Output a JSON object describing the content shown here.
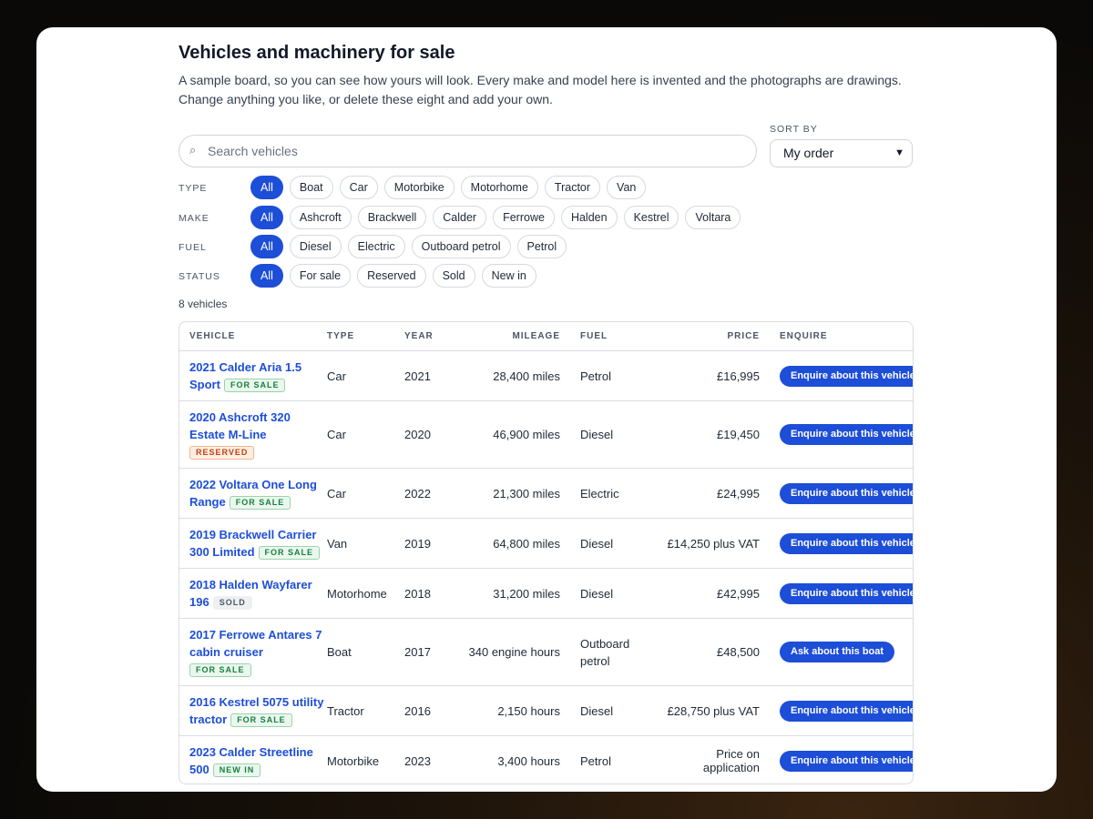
{
  "page": {
    "title": "Vehicles and machinery for sale",
    "intro": "A sample board, so you can see how yours will look. Every make and model here is invented and the photographs are drawings. Change anything you like, or delete these eight and add your own."
  },
  "search": {
    "placeholder": "Search vehicles",
    "icon": "search-icon"
  },
  "sort": {
    "label": "SORT BY",
    "selected": "My order"
  },
  "filters": {
    "type": {
      "label": "TYPE",
      "options": [
        "All",
        "Boat",
        "Car",
        "Motorbike",
        "Motorhome",
        "Tractor",
        "Van"
      ]
    },
    "make": {
      "label": "MAKE",
      "options": [
        "All",
        "Ashcroft",
        "Brackwell",
        "Calder",
        "Ferrowe",
        "Halden",
        "Kestrel",
        "Voltara"
      ]
    },
    "fuel": {
      "label": "FUEL",
      "options": [
        "All",
        "Diesel",
        "Electric",
        "Outboard petrol",
        "Petrol"
      ]
    },
    "status": {
      "label": "STATUS",
      "options": [
        "All",
        "For sale",
        "Reserved",
        "Sold",
        "New in"
      ]
    }
  },
  "results_count": "8 vehicles",
  "table": {
    "columns": {
      "vehicle": "VEHICLE",
      "type": "TYPE",
      "year": "YEAR",
      "mileage": "MILEAGE",
      "fuel": "FUEL",
      "price": "PRICE",
      "enquire": "ENQUIRE"
    },
    "rows": [
      {
        "line1": "2021 Calder Aria 1.5",
        "line2": "Sport",
        "badge": "FOR SALE",
        "badge_own_line": false,
        "type": "Car",
        "year": "2021",
        "mileage": "28,400 miles",
        "fuel": "Petrol",
        "price": "£16,995",
        "button": "Enquire about this vehicle"
      },
      {
        "line1": "2020 Ashcroft 320",
        "line2": "Estate M-Line",
        "badge": "RESERVED",
        "badge_own_line": true,
        "type": "Car",
        "year": "2020",
        "mileage": "46,900 miles",
        "fuel": "Diesel",
        "price": "£19,450",
        "button": "Enquire about this vehicle"
      },
      {
        "line1": "2022 Voltara One Long",
        "line2": "Range",
        "badge": "FOR SALE",
        "badge_own_line": false,
        "type": "Car",
        "year": "2022",
        "mileage": "21,300 miles",
        "fuel": "Electric",
        "price": "£24,995",
        "button": "Enquire about this vehicle"
      },
      {
        "line1": "2019 Brackwell Carrier",
        "line2": "300 Limited",
        "badge": "FOR SALE",
        "badge_own_line": false,
        "type": "Van",
        "year": "2019",
        "mileage": "64,800 miles",
        "fuel": "Diesel",
        "price": "£14,250 plus VAT",
        "button": "Enquire about this vehicle"
      },
      {
        "line1": "2018 Halden Wayfarer",
        "line2": "196",
        "badge": "SOLD",
        "badge_own_line": false,
        "type": "Motorhome",
        "year": "2018",
        "mileage": "31,200 miles",
        "fuel": "Diesel",
        "price": "£42,995",
        "button": "Enquire about this vehicle"
      },
      {
        "line1": "2017 Ferrowe Antares 7",
        "line2": "cabin cruiser",
        "badge": "FOR SALE",
        "badge_own_line": true,
        "type": "Boat",
        "year": "2017",
        "mileage": "340 engine hours",
        "fuel": "Outboard petrol",
        "price": "£48,500",
        "button": "Ask about this boat"
      },
      {
        "line1": "2016 Kestrel 5075 utility",
        "line2": "tractor",
        "badge": "FOR SALE",
        "badge_own_line": false,
        "type": "Tractor",
        "year": "2016",
        "mileage": "2,150 hours",
        "fuel": "Diesel",
        "price": "£28,750 plus VAT",
        "button": "Enquire about this vehicle"
      },
      {
        "line1": "2023 Calder Streetline",
        "line2": "500",
        "badge": "NEW IN",
        "badge_own_line": false,
        "type": "Motorbike",
        "year": "2023",
        "mileage": "3,400 hours",
        "fuel": "Petrol",
        "price": "Price on application",
        "button": "Enquire about this vehicle"
      }
    ]
  },
  "colors": {
    "accent": "#1d4ed8",
    "badge_for_sale": "#15803d",
    "badge_reserved": "#c2410c",
    "badge_sold": "#4b5563"
  }
}
